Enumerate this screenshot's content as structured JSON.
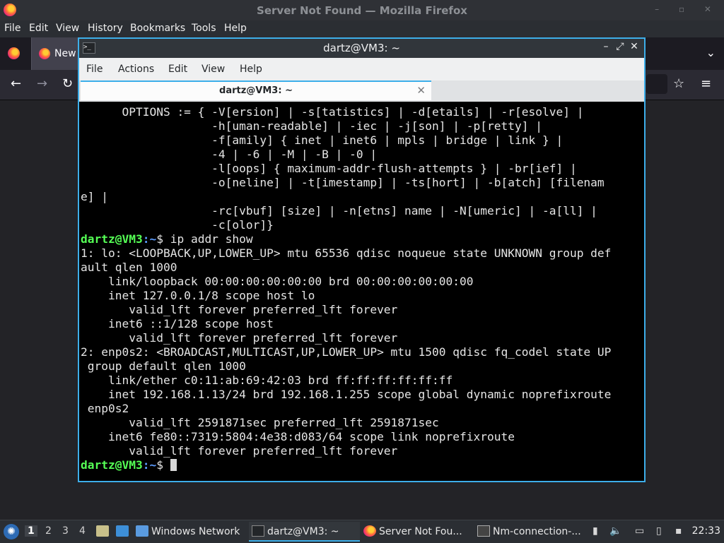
{
  "firefox": {
    "window_title": "Server Not Found — Mozilla Firefox",
    "menu": [
      "File",
      "Edit",
      "View",
      "History",
      "Bookmarks",
      "Tools",
      "Help"
    ],
    "tab_label": "New",
    "window_controls": "– ▫ ✕"
  },
  "terminal": {
    "window_title": "dartz@VM3: ~",
    "menu": [
      "File",
      "Actions",
      "Edit",
      "View",
      "Help"
    ],
    "tab_label": "dartz@VM3: ~",
    "lines": [
      {
        "t": "      OPTIONS := { -V[ersion] | -s[tatistics] | -d[etails] | -r[esolve] |"
      },
      {
        "t": "                   -h[uman-readable] | -iec | -j[son] | -p[retty] |"
      },
      {
        "t": "                   -f[amily] { inet | inet6 | mpls | bridge | link } |"
      },
      {
        "t": "                   -4 | -6 | -M | -B | -0 |"
      },
      {
        "t": "                   -l[oops] { maximum-addr-flush-attempts } | -br[ief] |"
      },
      {
        "t": "                   -o[neline] | -t[imestamp] | -ts[hort] | -b[atch] [filenam"
      },
      {
        "t": "e] |"
      },
      {
        "t": "                   -rc[vbuf] [size] | -n[etns] name | -N[umeric] | -a[ll] |"
      },
      {
        "t": "                   -c[olor]}"
      },
      {
        "user": "dartz@VM3",
        "path": ":~",
        "cmd": "$ ip addr show"
      },
      {
        "t": "1: lo: <LOOPBACK,UP,LOWER_UP> mtu 65536 qdisc noqueue state UNKNOWN group def"
      },
      {
        "t": "ault qlen 1000"
      },
      {
        "t": "    link/loopback 00:00:00:00:00:00 brd 00:00:00:00:00:00"
      },
      {
        "t": "    inet 127.0.0.1/8 scope host lo"
      },
      {
        "t": "       valid_lft forever preferred_lft forever"
      },
      {
        "t": "    inet6 ::1/128 scope host"
      },
      {
        "t": "       valid_lft forever preferred_lft forever"
      },
      {
        "t": "2: enp0s2: <BROADCAST,MULTICAST,UP,LOWER_UP> mtu 1500 qdisc fq_codel state UP"
      },
      {
        "t": " group default qlen 1000"
      },
      {
        "t": "    link/ether c0:11:ab:69:42:03 brd ff:ff:ff:ff:ff:ff"
      },
      {
        "t": "    inet 192.168.1.13/24 brd 192.168.1.255 scope global dynamic noprefixroute"
      },
      {
        "t": " enp0s2"
      },
      {
        "t": "       valid_lft 2591871sec preferred_lft 2591871sec"
      },
      {
        "t": "    inet6 fe80::7319:5804:4e38:d083/64 scope link noprefixroute"
      },
      {
        "t": "       valid_lft forever preferred_lft forever"
      },
      {
        "user": "dartz@VM3",
        "path": ":~",
        "cmd": "$ ",
        "cursor": true
      }
    ]
  },
  "taskbar": {
    "workspaces": [
      "1",
      "2",
      "3",
      "4"
    ],
    "tasks": [
      {
        "label": "Windows Network",
        "icon": "folder-icon"
      },
      {
        "label": "dartz@VM3: ~",
        "icon": "terminal-icon",
        "active": true
      },
      {
        "label": "Server Not Fou...",
        "icon": "firefox-icon"
      },
      {
        "label": "Nm-connection-...",
        "icon": "network-icon"
      }
    ],
    "clock": "22:33"
  }
}
